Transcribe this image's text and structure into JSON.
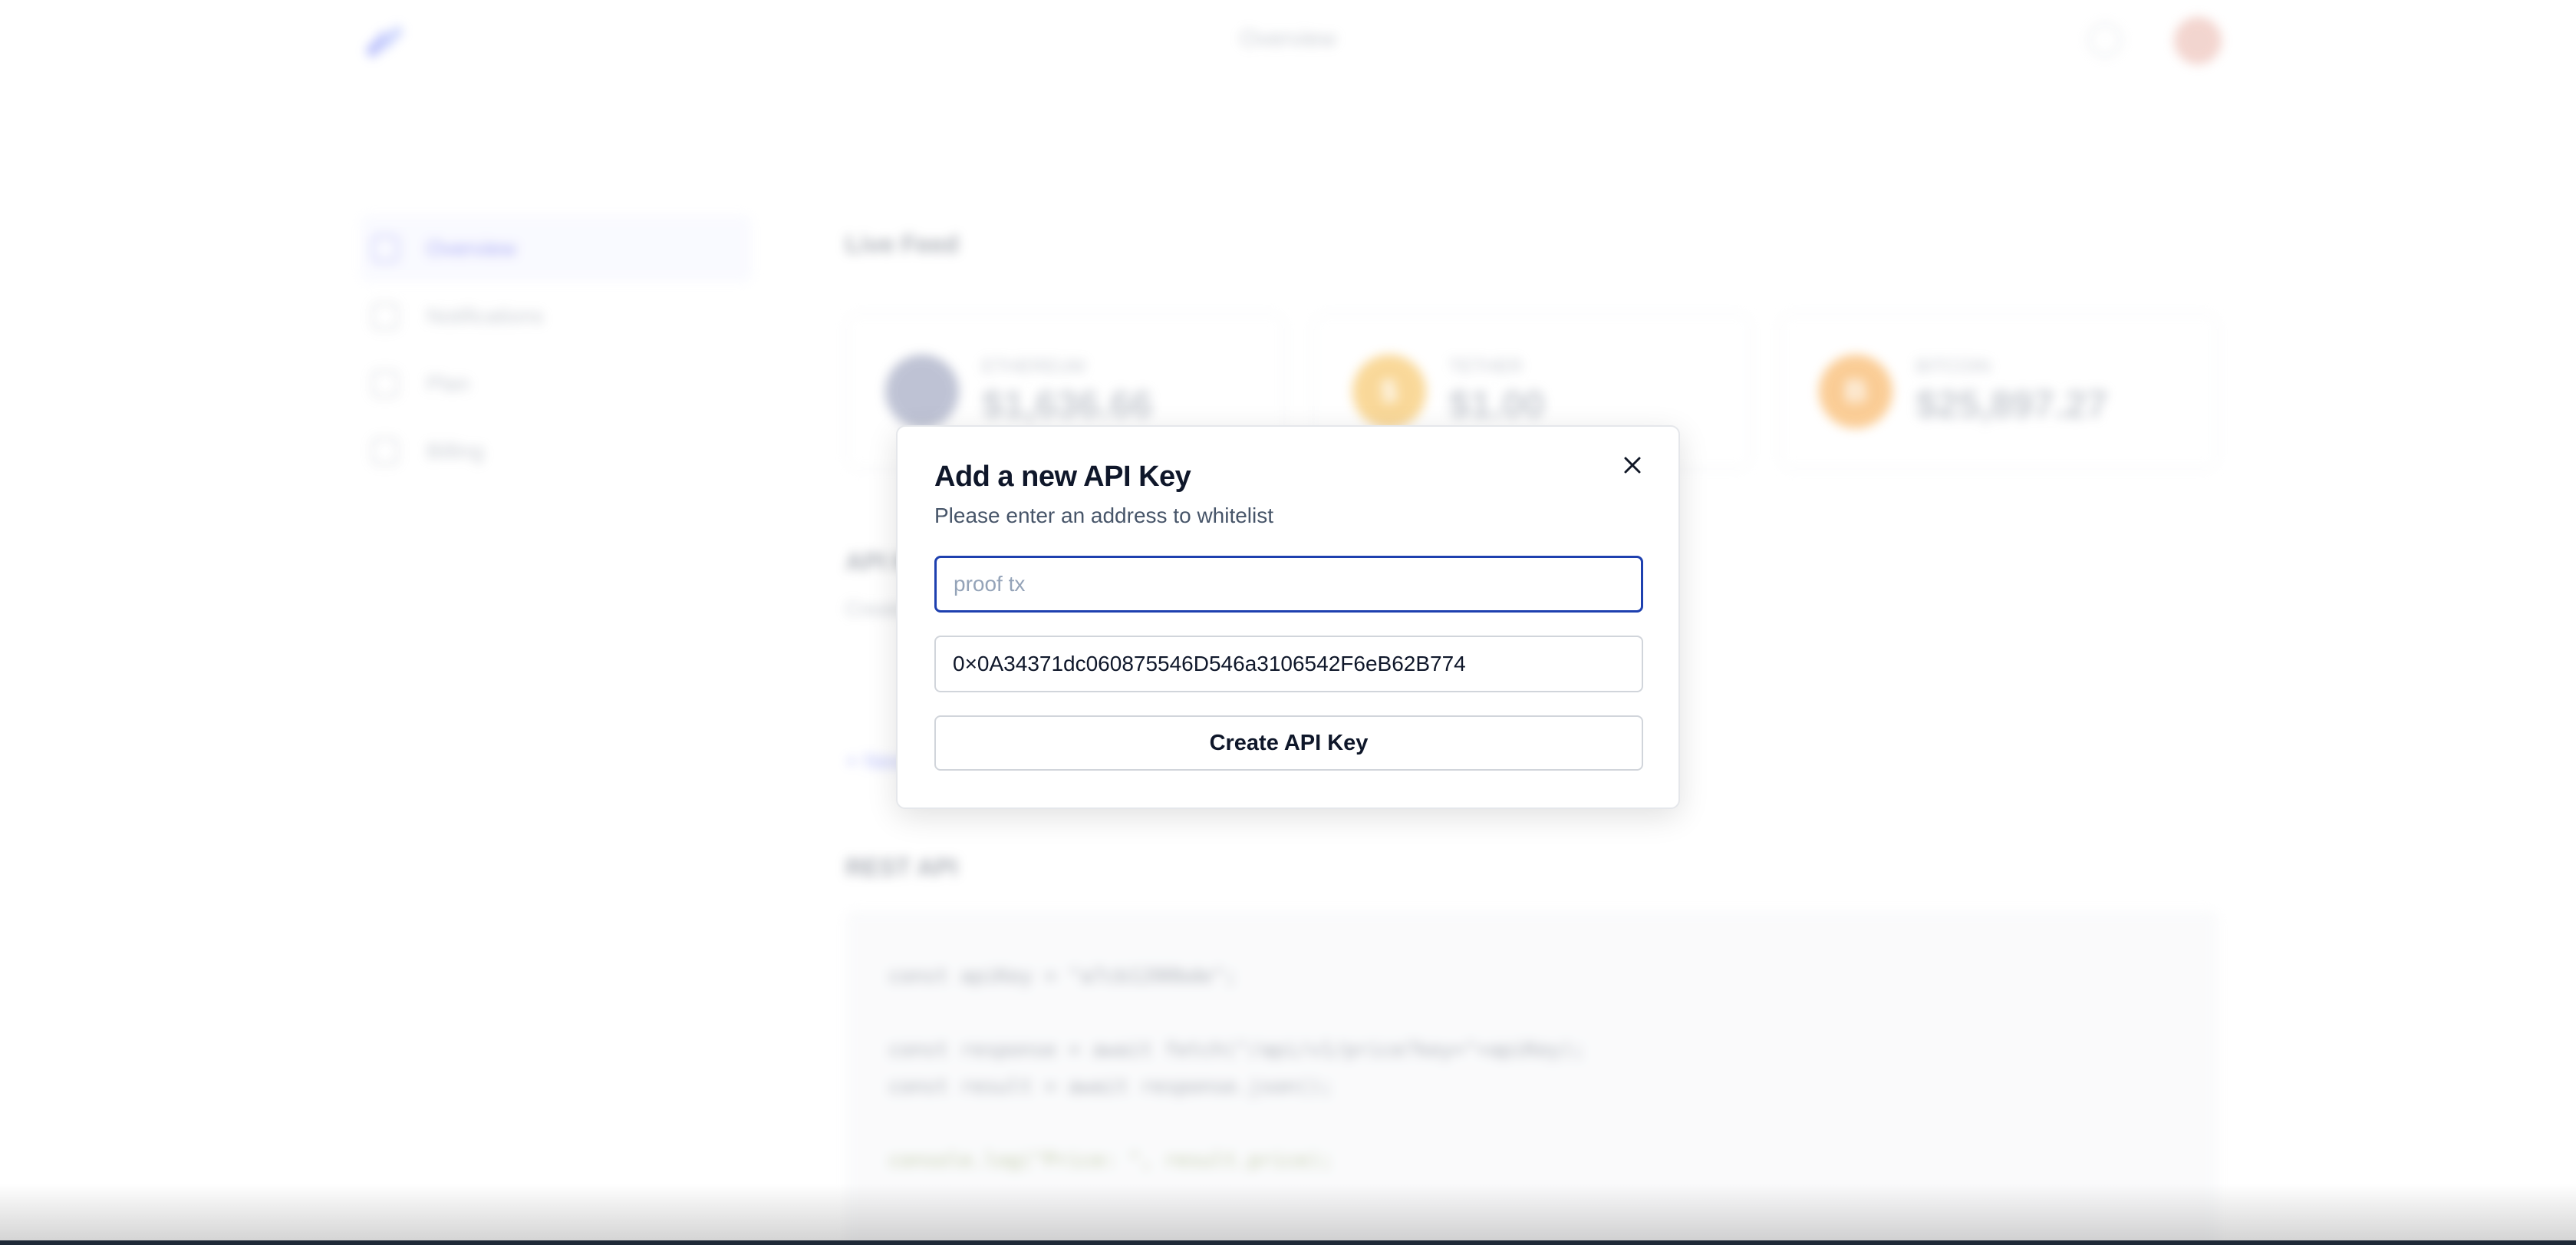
{
  "header": {
    "title": "Overview",
    "logo_icon": "logo-icon",
    "bell_icon": "bell-icon",
    "avatar_icon": "avatar-icon"
  },
  "sidebar": {
    "items": [
      {
        "label": "Overview",
        "icon": "grid-icon",
        "active": true
      },
      {
        "label": "Notifications",
        "icon": "bell-icon",
        "active": false
      },
      {
        "label": "Plan",
        "icon": "plan-icon",
        "active": false
      },
      {
        "label": "Billing",
        "icon": "billing-icon",
        "active": false
      }
    ]
  },
  "main": {
    "live_feed_title": "Live Feed",
    "cards": [
      {
        "name": "ETHEREUM",
        "price": "$1,636.66",
        "color": "#8a92b2",
        "symbol": ""
      },
      {
        "name": "TETHER",
        "price": "$1.00",
        "color": "#f5b946",
        "symbol": "$"
      },
      {
        "name": "BITCOIN",
        "price": "$25,897.27",
        "color": "#f7a440",
        "symbol": "B"
      }
    ],
    "api_title": "API Keys",
    "api_subtitle": "Create and manage your API keys",
    "add_link": "+ New API Key",
    "rest_title": "REST API",
    "code": {
      "line1": "const apiKey = \"a7cb1200bde\";",
      "line2": "const response = await fetch(\"/api/v1/price?key=\"+apiKey);",
      "line3": "const result = await response.json();",
      "line4": "console.log(\"Price: \", result.price);"
    }
  },
  "modal": {
    "title": "Add a new API Key",
    "subtitle": "Please enter an address to whitelist",
    "input_placeholder": "proof tx",
    "input_value": "",
    "address_value": "0×0A34371dc060875546D546a3106542F6eB62B774",
    "submit_label": "Create API Key",
    "close_icon": "close-icon"
  },
  "colors": {
    "accent": "#1e40af",
    "brand": "#6366f1",
    "border": "#d1d5db"
  }
}
